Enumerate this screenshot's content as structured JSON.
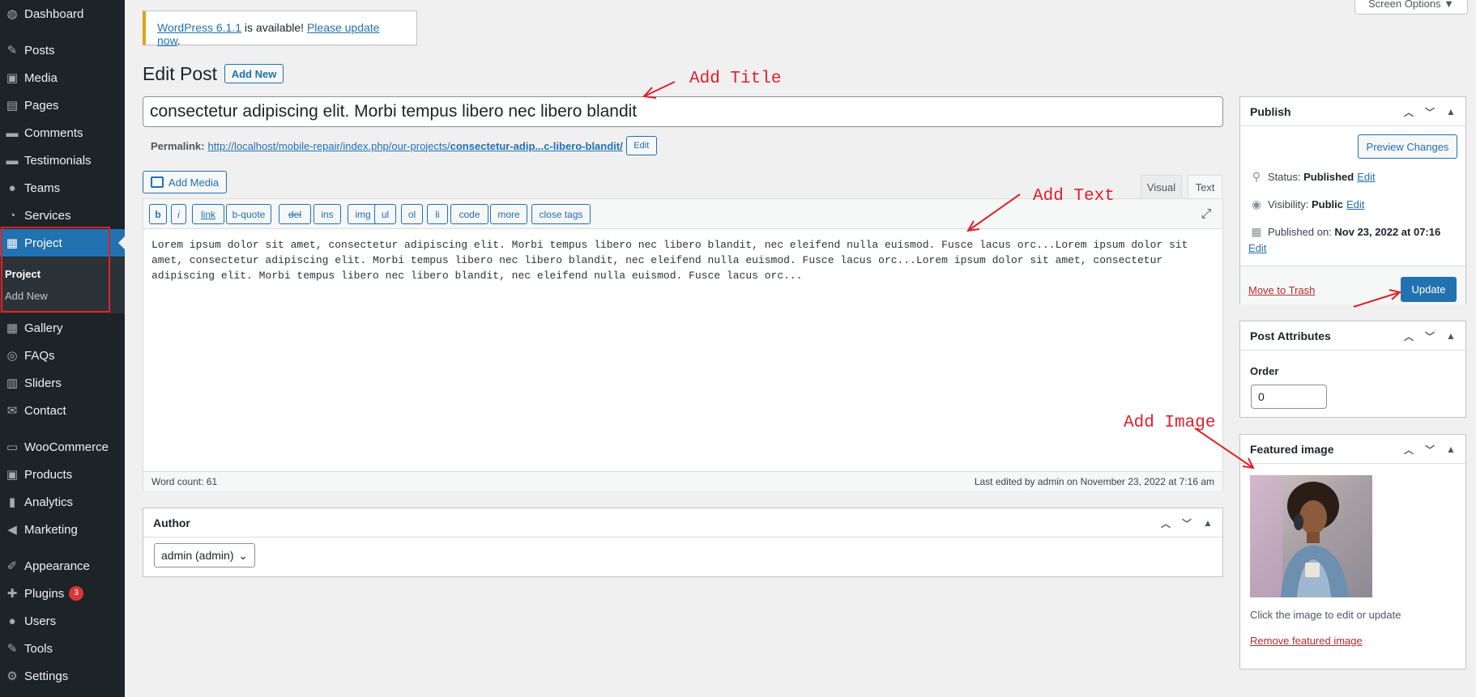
{
  "sidebar": {
    "items": [
      {
        "icon": "dashboard-icon",
        "glyph": "◍",
        "label": "Dashboard"
      },
      {
        "icon": "pushpin-icon",
        "glyph": "✎",
        "label": "Posts"
      },
      {
        "icon": "media-icon",
        "glyph": "▣",
        "label": "Media"
      },
      {
        "icon": "pages-icon",
        "glyph": "▤",
        "label": "Pages"
      },
      {
        "icon": "comments-icon",
        "glyph": "▬",
        "label": "Comments"
      },
      {
        "icon": "testimonials-icon",
        "glyph": "▬",
        "label": "Testimonials"
      },
      {
        "icon": "teams-icon",
        "glyph": "●",
        "label": "Teams"
      },
      {
        "icon": "services-icon",
        "glyph": "◔",
        "label": "Services"
      },
      {
        "icon": "project-icon",
        "glyph": "▦",
        "label": "Project"
      },
      {
        "icon": "gallery-icon",
        "glyph": "▦",
        "label": "Gallery"
      },
      {
        "icon": "faqs-icon",
        "glyph": "◎",
        "label": "FAQs"
      },
      {
        "icon": "sliders-icon",
        "glyph": "▥",
        "label": "Sliders"
      },
      {
        "icon": "contact-icon",
        "glyph": "✉",
        "label": "Contact"
      },
      {
        "icon": "woocommerce-icon",
        "glyph": "▭",
        "label": "WooCommerce"
      },
      {
        "icon": "products-icon",
        "glyph": "▣",
        "label": "Products"
      },
      {
        "icon": "analytics-icon",
        "glyph": "▮",
        "label": "Analytics"
      },
      {
        "icon": "marketing-icon",
        "glyph": "◀",
        "label": "Marketing"
      },
      {
        "icon": "appearance-icon",
        "glyph": "✐",
        "label": "Appearance"
      },
      {
        "icon": "plugins-icon",
        "glyph": "✚",
        "label": "Plugins"
      },
      {
        "icon": "users-icon",
        "glyph": "●",
        "label": "Users"
      },
      {
        "icon": "tools-icon",
        "glyph": "✎",
        "label": "Tools"
      },
      {
        "icon": "settings-icon",
        "glyph": "⚙",
        "label": "Settings"
      }
    ],
    "submenu": [
      "Project",
      "Add New"
    ],
    "plugins_badge": "3",
    "active_color": "#2271b1"
  },
  "notice": {
    "link1": "WordPress 6.1.1",
    "middle": " is available! ",
    "link2": "Please update now",
    "end": "."
  },
  "screen_options": "Screen Options ▼",
  "page": {
    "title": "Edit Post",
    "add_new": "Add New",
    "post_title": "consectetur adipiscing elit. Morbi tempus libero nec libero blandit",
    "permalink_label": "Permalink:",
    "permalink_base": "http://localhost/mobile-repair/index.php/our-projects/",
    "permalink_slug": "consectetur-adip...c-libero-blandit/",
    "permalink_edit": "Edit"
  },
  "editor": {
    "add_media": "Add Media",
    "tabs": [
      "Visual",
      "Text"
    ],
    "quicktags": [
      "b",
      "i",
      "link",
      "b-quote",
      "del",
      "ins",
      "img",
      "ul",
      "ol",
      "li",
      "code",
      "more",
      "close tags"
    ],
    "content": "Lorem ipsum dolor sit amet, consectetur adipiscing elit. Morbi tempus libero nec libero blandit, nec eleifend nulla euismod. Fusce lacus orc...Lorem ipsum dolor sit amet, consectetur adipiscing elit. Morbi tempus libero nec libero blandit, nec eleifend nulla euismod. Fusce lacus orc...Lorem ipsum dolor sit amet, consectetur adipiscing elit. Morbi tempus libero nec libero blandit, nec eleifend nulla euismod. Fusce lacus orc...",
    "word_count": "Word count: 61",
    "last_edited": "Last edited by admin on November 23, 2022 at 7:16 am"
  },
  "author": {
    "title": "Author",
    "selected": "admin (admin)"
  },
  "publish": {
    "title": "Publish",
    "preview": "Preview Changes",
    "status_label": "Status:",
    "status_value": "Published",
    "visibility_label": "Visibility:",
    "visibility_value": "Public",
    "published_label": "Published on:",
    "published_value": "Nov 23, 2022 at 07:16",
    "edit": "Edit",
    "trash": "Move to Trash",
    "update": "Update"
  },
  "attributes": {
    "title": "Post Attributes",
    "order_label": "Order",
    "order_value": "0"
  },
  "featured": {
    "title": "Featured image",
    "hint": "Click the image to edit or update",
    "remove": "Remove featured image"
  },
  "annotations": {
    "title": "Add Title",
    "text": "Add Text",
    "image": "Add Image",
    "color": "#e0202a"
  }
}
